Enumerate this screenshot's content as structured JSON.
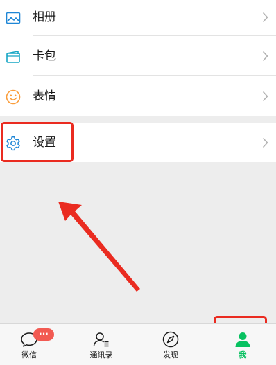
{
  "menu": {
    "album": {
      "label": "相册",
      "icon": "album-icon"
    },
    "cards": {
      "label": "卡包",
      "icon": "card-wallet-icon"
    },
    "sticker": {
      "label": "表情",
      "icon": "smiley-icon"
    },
    "settings": {
      "label": "设置",
      "icon": "gear-icon"
    }
  },
  "tabbar": {
    "chats": {
      "label": "微信",
      "icon": "chat-bubble-icon",
      "badge": "···"
    },
    "contacts": {
      "label": "通讯录",
      "icon": "contacts-icon"
    },
    "discover": {
      "label": "发现",
      "icon": "compass-icon"
    },
    "me": {
      "label": "我",
      "icon": "person-icon"
    }
  },
  "colors": {
    "background": "#ededed",
    "accent_green": "#07c160",
    "icon_blue": "#1e86d6",
    "icon_orange": "#fa9d3b",
    "annotation_red": "#ea2b20",
    "badge_red": "#f25a52"
  }
}
